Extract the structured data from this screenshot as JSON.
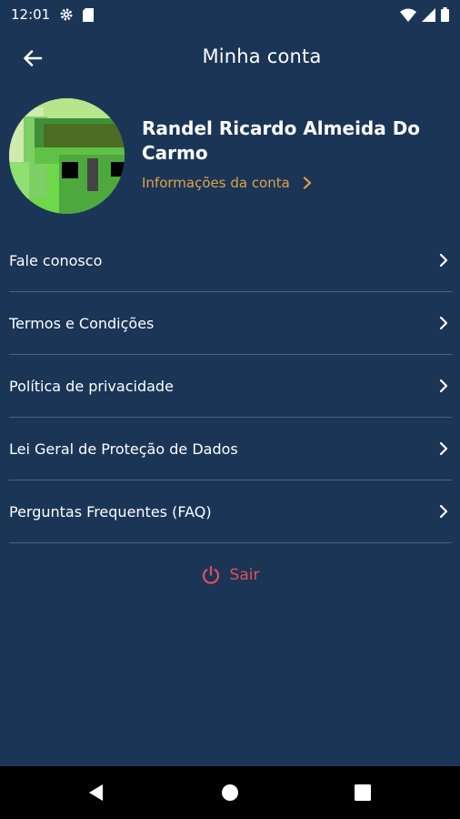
{
  "status_bar": {
    "time": "12:01",
    "icons": [
      "gear-icon",
      "sd-card-icon",
      "wifi-icon",
      "signal-icon",
      "battery-icon"
    ]
  },
  "header": {
    "title": "Minha conta",
    "back_icon": "arrow-left-icon"
  },
  "profile": {
    "name": "Randel Ricardo Almeida Do Carmo",
    "account_link": "Informações da conta"
  },
  "menu": {
    "items": [
      {
        "label": "Fale conosco"
      },
      {
        "label": "Termos e Condições"
      },
      {
        "label": "Política de privacidade"
      },
      {
        "label": "Lei Geral de Proteção de Dados"
      },
      {
        "label": "Perguntas Frequentes (FAQ)"
      }
    ]
  },
  "logout": {
    "label": "Sair"
  },
  "colors": {
    "background": "#1b3557",
    "accent": "#e0a24a",
    "danger": "#e0505a",
    "divider": "#4a6385"
  }
}
